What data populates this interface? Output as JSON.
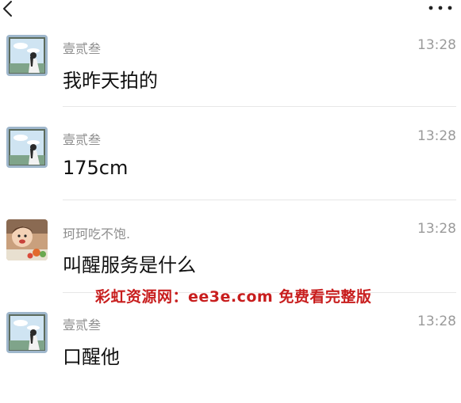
{
  "header": {
    "back_icon": "chevron-left-icon",
    "more_icon": "more-horizontal-icon"
  },
  "messages": [
    {
      "sender": "壹贰叁",
      "time": "13:28",
      "text": "我昨天拍的",
      "avatar": "scenic-avatar"
    },
    {
      "sender": "壹贰叁",
      "time": "13:28",
      "text": "175cm",
      "avatar": "scenic-avatar"
    },
    {
      "sender": "珂珂吃不饱.",
      "time": "13:28",
      "text": "叫醒服务是什么",
      "avatar": "child-avatar"
    },
    {
      "sender": "壹贰叁",
      "time": "13:28",
      "text": "口醒他",
      "avatar": "scenic-avatar"
    }
  ],
  "watermark": {
    "text": "彩虹资源网：ee3e.com 免费看完整版",
    "color": "#c81e1e"
  }
}
